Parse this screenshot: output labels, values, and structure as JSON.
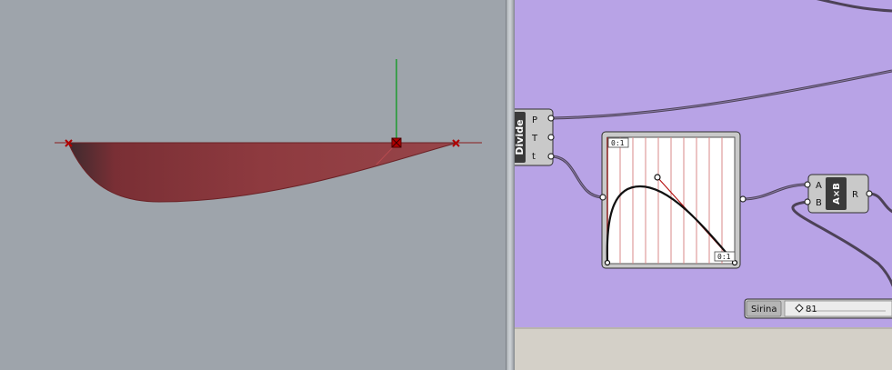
{
  "divide": {
    "name": "Divide",
    "outputs": [
      "P",
      "T",
      "t"
    ]
  },
  "graph_mapper": {
    "domain_top_left": "0:1",
    "domain_bottom_right": "0:1"
  },
  "multiply": {
    "inputs": [
      "A",
      "B"
    ],
    "output": "R",
    "symbol": "A×B"
  },
  "slider": {
    "name": "Sirina",
    "value": "81"
  },
  "colors": {
    "canvas": "#b8a3e6",
    "viewport": "#9ea4ab",
    "surface": "#8e3a3f",
    "wire": "#4d4257"
  }
}
